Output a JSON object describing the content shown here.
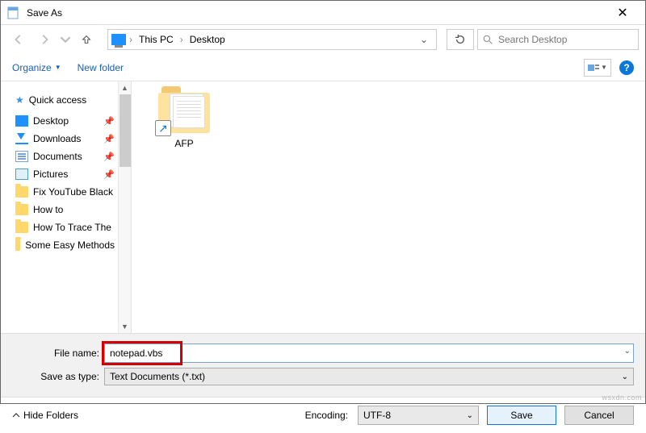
{
  "window": {
    "title": "Save As"
  },
  "nav": {
    "location_root": "This PC",
    "location_leaf": "Desktop",
    "search_placeholder": "Search Desktop"
  },
  "toolbar": {
    "organize": "Organize",
    "new_folder": "New folder"
  },
  "sidebar": {
    "quick_access": "Quick access",
    "items": [
      {
        "label": "Desktop"
      },
      {
        "label": "Downloads"
      },
      {
        "label": "Documents"
      },
      {
        "label": "Pictures"
      },
      {
        "label": "Fix YouTube Black"
      },
      {
        "label": "How to"
      },
      {
        "label": "How To Trace The"
      },
      {
        "label": "Some Easy Methods"
      }
    ]
  },
  "content": {
    "items": [
      {
        "name": "AFP"
      }
    ]
  },
  "save": {
    "filename_label": "File name:",
    "filename_value": "notepad.vbs",
    "type_label": "Save as type:",
    "type_value": "Text Documents (*.txt)",
    "encoding_label": "Encoding:",
    "encoding_value": "UTF-8",
    "hide_folders": "Hide Folders",
    "save_btn": "Save",
    "cancel_btn": "Cancel"
  },
  "watermark": "wsxdn.com"
}
